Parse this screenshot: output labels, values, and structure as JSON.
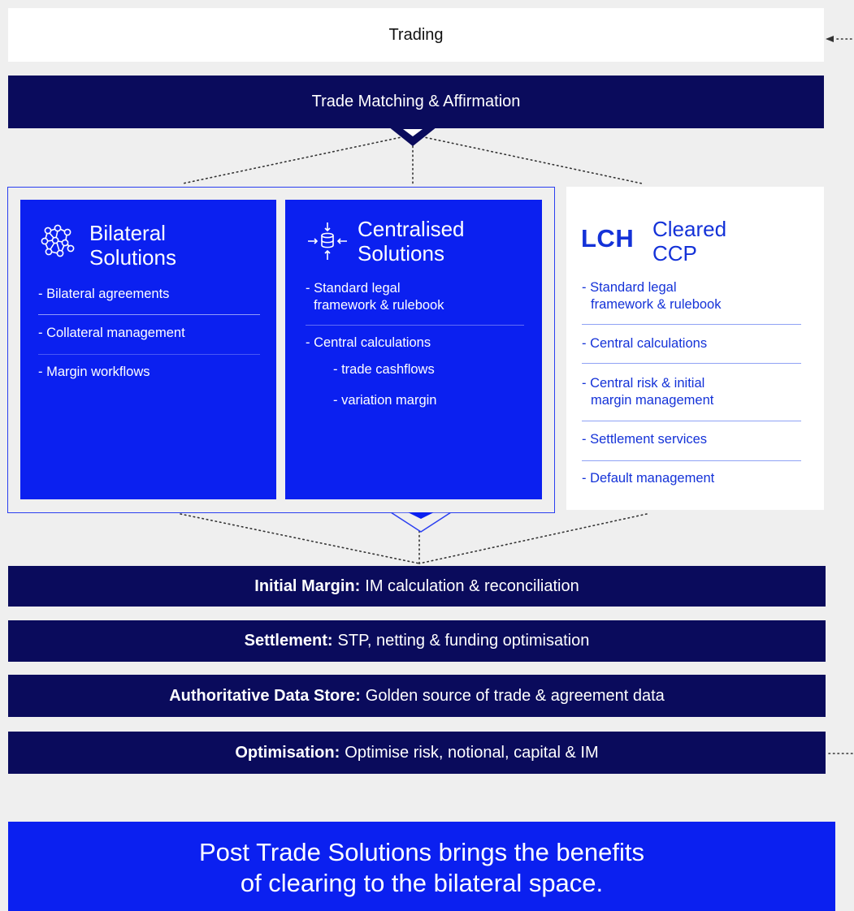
{
  "colors": {
    "navy": "#0a0b5c",
    "blue": "#0b20f0",
    "background": "#efefef",
    "lch_text": "#1432d8"
  },
  "trading": {
    "label": "Trading"
  },
  "matching": {
    "label": "Trade Matching & Affirmation"
  },
  "bilateral": {
    "icon": "network-icon",
    "title_line1": "Bilateral",
    "title_line2": "Solutions",
    "items": [
      "- Bilateral agreements",
      "- Collateral management",
      "- Margin workflows"
    ]
  },
  "centralised": {
    "icon": "database-arrows-icon",
    "title_line1": "Centralised",
    "title_line2": "Solutions",
    "item1_line1": "- Standard legal",
    "item1_line2": "framework & rulebook",
    "item2": "- Central calculations",
    "sub1": "- trade cashflows",
    "sub2": "- variation margin"
  },
  "lch": {
    "logo": "LCH",
    "title_line1": "Cleared",
    "title_line2": "CCP",
    "item1_line1": "- Standard legal",
    "item1_line2": "framework & rulebook",
    "item2": "- Central calculations",
    "item3_line1": "- Central risk & initial",
    "item3_line2": "margin management",
    "item4": "- Settlement services",
    "item5": "- Default management"
  },
  "services": [
    {
      "bold": "Initial Margin:",
      "text": "IM calculation & reconciliation"
    },
    {
      "bold": "Settlement:",
      "text": "STP, netting & funding optimisation"
    },
    {
      "bold": "Authoritative Data Store:",
      "text": "Golden source of trade & agreement data"
    },
    {
      "bold": "Optimisation:",
      "text": "Optimise risk, notional, capital & IM"
    }
  ],
  "footer": {
    "line1": "Post Trade Solutions brings the benefits",
    "line2": "of clearing to the bilateral space."
  }
}
